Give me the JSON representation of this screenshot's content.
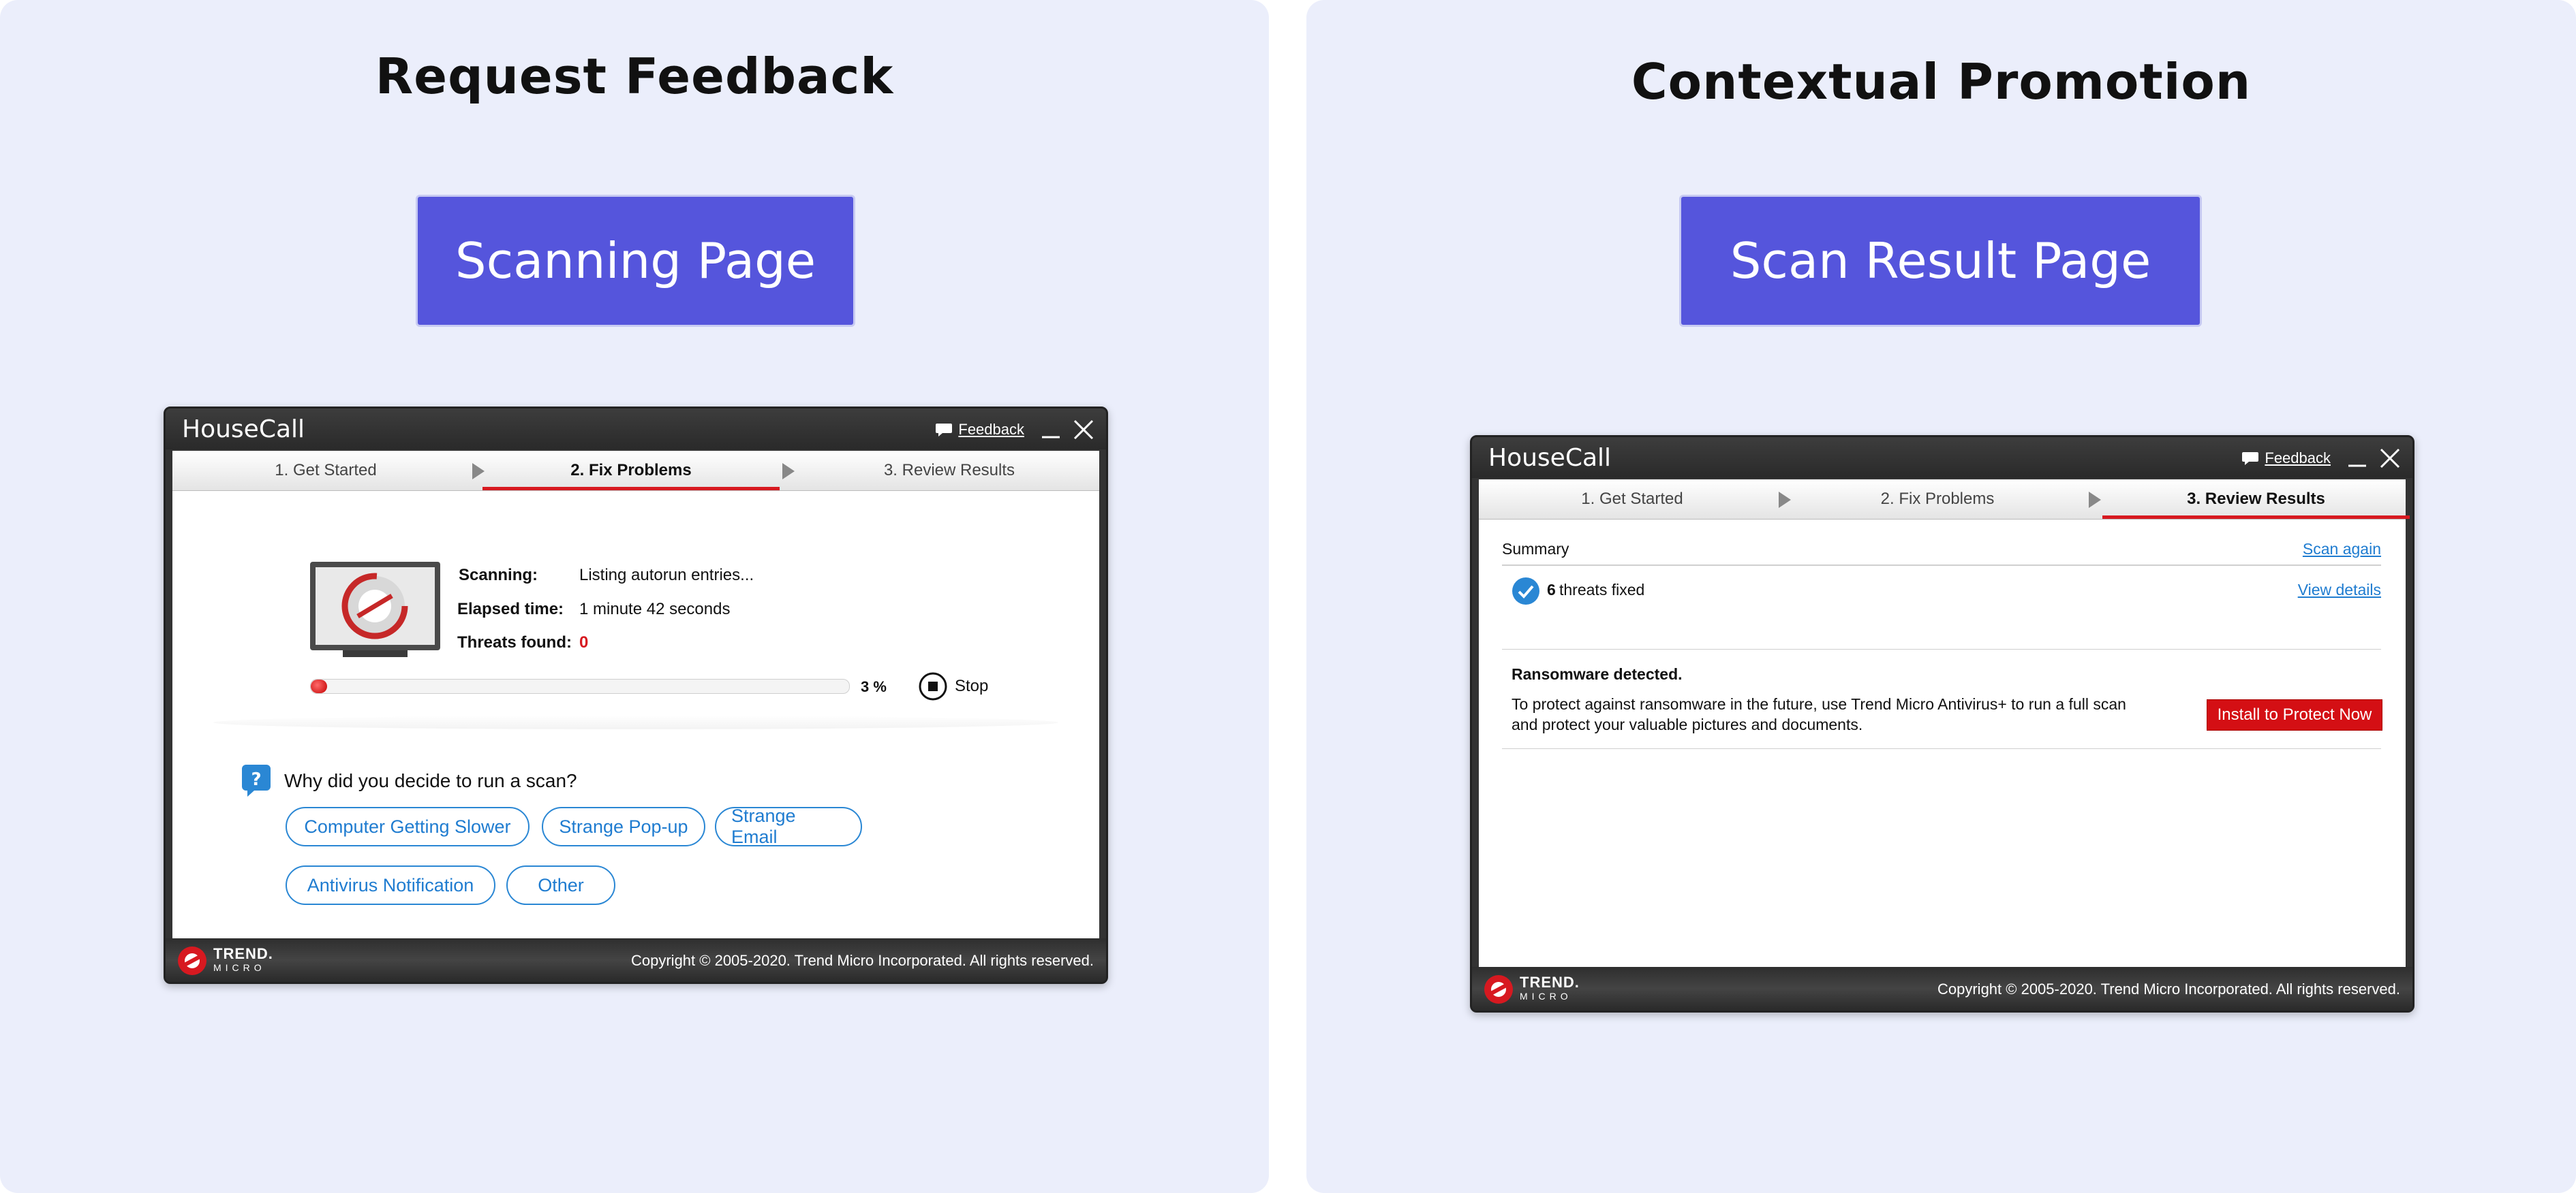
{
  "left_panel": {
    "heading": "Request Feedback",
    "cta_label": "Scanning Page",
    "window": {
      "app_title": "HouseCall",
      "feedback_label": "Feedback",
      "steps": [
        "1. Get Started",
        "2. Fix Problems",
        "3. Review Results"
      ],
      "active_step": 2,
      "scan": {
        "scanning_label": "Scanning:",
        "scanning_value": "Listing autorun entries...",
        "elapsed_label": "Elapsed time:",
        "elapsed_value": "1 minute 42 seconds",
        "threats_label": "Threats found:",
        "threats_value": "0",
        "progress_percent": 3,
        "progress_text": "3 %",
        "stop_label": "Stop"
      },
      "question": "Why did you decide to run a scan?",
      "options": [
        "Computer Getting Slower",
        "Strange Pop-up",
        "Strange Email",
        "Antivirus Notification",
        "Other"
      ],
      "copyright": "Copyright © 2005-2020. Trend Micro Incorporated. All rights reserved.",
      "logo_top": "TREND.",
      "logo_bottom": "MICRO"
    }
  },
  "right_panel": {
    "heading": "Contextual Promotion",
    "cta_label": "Scan Result Page",
    "window": {
      "app_title": "HouseCall",
      "feedback_label": "Feedback",
      "steps": [
        "1. Get Started",
        "2. Fix Problems",
        "3. Review Results"
      ],
      "active_step": 3,
      "summary_label": "Summary",
      "scan_again": "Scan again",
      "threats_count": "6",
      "threats_text": "threats fixed",
      "view_details": "View details",
      "promo_title": "Ransomware detected.",
      "promo_body_1": "To protect against ransomware in the future, use Trend Micro Antivirus+ to run a full scan",
      "promo_body_2": "and protect your valuable pictures and documents.",
      "install_label": "Install to Protect Now",
      "copyright": "Copyright © 2005-2020. Trend Micro Incorporated. All rights reserved.",
      "logo_top": "TREND.",
      "logo_bottom": "MICRO"
    }
  },
  "colors": {
    "panel_bg": "#ebeefb",
    "cta_bg": "#5555dc",
    "accent_red": "#d71920",
    "link_blue": "#1f7cd0"
  }
}
